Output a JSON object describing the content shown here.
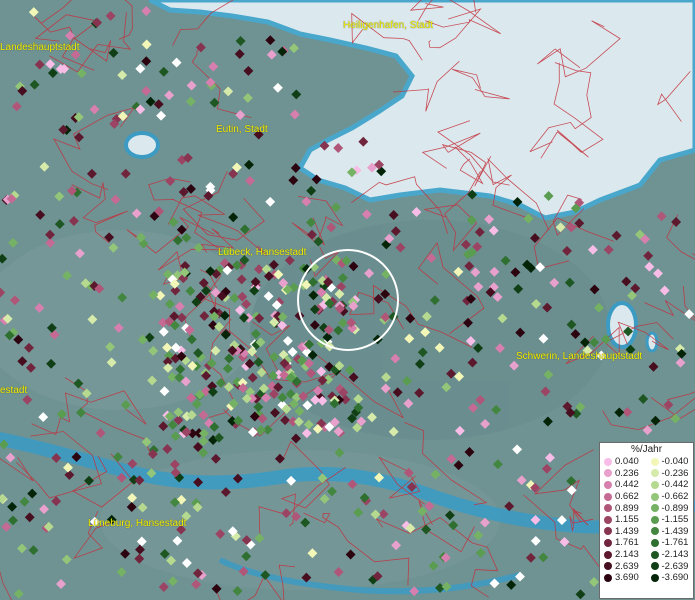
{
  "cities": [
    {
      "name": "Heiligenhafen, Stadt"
    },
    {
      "name": "Landeshauptstadt"
    },
    {
      "name": "Eutin, Stadt"
    },
    {
      "name": "Lübeck, Hansestadt"
    },
    {
      "name": "Schwerin, Landeshauptstadt"
    },
    {
      "name": "estadt"
    },
    {
      "name": "Lüneburg, Hansestadt"
    }
  ],
  "legend": {
    "title": "%/Jahr",
    "positive": [
      {
        "label": "0.040",
        "color": "#f7bde6"
      },
      {
        "label": "0.236",
        "color": "#e8a0cc"
      },
      {
        "label": "0.442",
        "color": "#d77fae"
      },
      {
        "label": "0.662",
        "color": "#c46a93"
      },
      {
        "label": "0.899",
        "color": "#b05779"
      },
      {
        "label": "1.155",
        "color": "#9b4463"
      },
      {
        "label": "1.439",
        "color": "#86344f"
      },
      {
        "label": "1.761",
        "color": "#71253d"
      },
      {
        "label": "2.143",
        "color": "#5c182d"
      },
      {
        "label": "2.639",
        "color": "#460e1f"
      },
      {
        "label": "3.690",
        "color": "#2c0410"
      }
    ],
    "negative": [
      {
        "label": "-0.040",
        "color": "#f2f7b8"
      },
      {
        "label": "-0.236",
        "color": "#d6ebaa"
      },
      {
        "label": "-0.442",
        "color": "#b5d98f"
      },
      {
        "label": "-0.662",
        "color": "#93c679"
      },
      {
        "label": "-0.899",
        "color": "#75b264"
      },
      {
        "label": "-1.155",
        "color": "#5a9c50"
      },
      {
        "label": "-1.439",
        "color": "#43863f"
      },
      {
        "label": "-1.761",
        "color": "#2f6f30"
      },
      {
        "label": "-2.143",
        "color": "#1e5722"
      },
      {
        "label": "-2.639",
        "color": "#103f15"
      },
      {
        "label": "-3.690",
        "color": "#042408"
      }
    ]
  },
  "colors": {
    "land": "#6f9293",
    "sea": "#dbe9ee",
    "water": "#3c9bc3",
    "boundary": "#c4303b",
    "label": "#f2f200"
  }
}
